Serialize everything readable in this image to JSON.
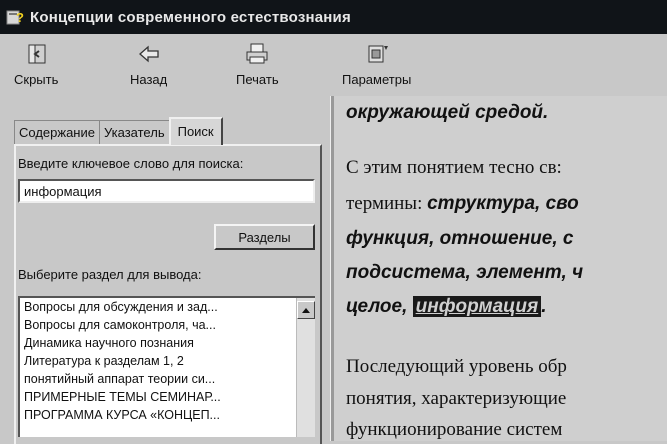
{
  "window": {
    "title": "Концепции современного естествознания",
    "icon": "help-icon"
  },
  "toolbar": {
    "hide": {
      "label": "Скрыть",
      "icon": "hide-pane-icon"
    },
    "back": {
      "label": "Назад",
      "icon": "back-arrow-icon"
    },
    "print": {
      "label": "Печать",
      "icon": "printer-icon"
    },
    "options": {
      "label": "Параметры",
      "icon": "options-icon"
    }
  },
  "tabs": [
    {
      "label": "Содержание",
      "active": false
    },
    {
      "label": "Указатель",
      "active": false
    },
    {
      "label": "Поиск",
      "active": true
    }
  ],
  "search": {
    "prompt": "Введите ключевое слово для поиска:",
    "value": "информация",
    "sections_button": "Разделы",
    "list_prompt": "Выберите раздел для вывода:",
    "results": [
      "Вопросы для обсуждения и зад...",
      "Вопросы для самоконтроля, ча...",
      "Динамика научного познания",
      "Литература к разделам 1, 2",
      "понятийный аппарат теории си...",
      "ПРИМЕРНЫЕ ТЕМЫ СЕМИНАР...",
      "ПРОГРАММА КУРСА «КОНЦЕП..."
    ]
  },
  "content": {
    "line1": "окружающей средой.",
    "line2": "С этим понятием тесно св:",
    "line3_plain": "термины: ",
    "line3_italic": "структура, сво",
    "line4": "функция, отношение, с",
    "line5": "подсистема, элемент, ч",
    "line6_plain": "целое, ",
    "line6_highlight": "информация",
    "line6_end": ".",
    "line7": "Последующий уровень обр",
    "line8": "понятия, характеризующие",
    "line9": "функционирование систем"
  }
}
